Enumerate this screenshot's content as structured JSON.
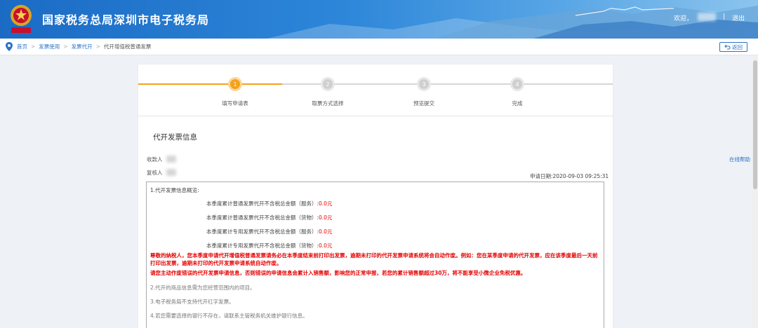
{
  "header": {
    "site_title": "国家税务总局深圳市电子税务局",
    "welcome": "欢迎，",
    "separator": "|",
    "logout": "退出"
  },
  "breadcrumb": {
    "items": [
      "首页",
      "发票使用",
      "发票代开",
      "代开增值税普通发票"
    ],
    "separator": ">",
    "back": "返回"
  },
  "help_link": "在线帮助",
  "steps": [
    {
      "num": "1",
      "label": "填写申请表"
    },
    {
      "num": "2",
      "label": "取票方式选择"
    },
    {
      "num": "3",
      "label": "预览提交"
    },
    {
      "num": "4",
      "label": "完成"
    }
  ],
  "section_title": "代开发票信息",
  "payee_label": "收款人",
  "reviewer_label": "复核人",
  "apply_date": "申请日期:2020-09-03 09:25:31",
  "notice": {
    "heading": "1.代开发票信息概览:",
    "lines": [
      {
        "text": "本季度累计普通发票代开不含税总金额（服务）:",
        "value": "0.0元"
      },
      {
        "text": "本季度累计普通发票代开不含税总金额（货物）:",
        "value": "0.0元"
      },
      {
        "text": "本季度累计专用发票代开不含税总金额（服务）:",
        "value": "0.0元"
      },
      {
        "text": "本季度累计专用发票代开不含税总金额（货物）:",
        "value": "0.0元"
      }
    ],
    "warning1": "尊敬的纳税人，您本季度申请代开增值税普通发票请务必在本季度结束前打印出发票，逾期未打印的代开发票申请系统将会自动作废。例如：您在某季度申请的代开发票，应在该季度最后一天前打印出发票，逾期未打印的代开发票申请系统自动作废。",
    "warning2": "请您主动作废错误的代开发票申请信息，否则错误的申请信息会累计入销售额，影响您的正常申报，若您的累计销售额超过30万，将不能享受小微企业免税优惠。",
    "item2": "2.代开的商品信息需为您经营范围内的项目。",
    "item3": "3.电子税务局不支持代开红字发票。",
    "item4": "4.若您需要选择的银行不存在，请联系主管税务机关维护银行信息。"
  },
  "colors": {
    "brand_blue": "#2b73c7",
    "step_active": "#f5a11c",
    "warning_red": "#e60000"
  }
}
